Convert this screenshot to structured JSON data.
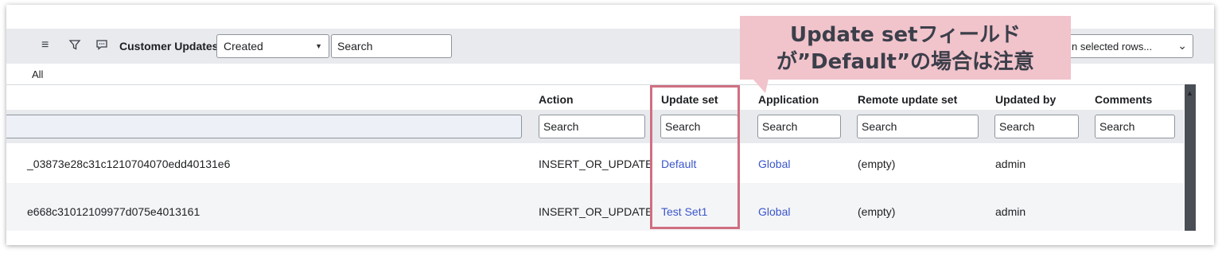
{
  "toolbar": {
    "title": "Customer Updates",
    "field_select": "Created",
    "search_value": "Search",
    "actions_select": "n selected rows..."
  },
  "breadcrumb": "All",
  "columns": [
    "Action",
    "Update set",
    "Application",
    "Remote update set",
    "Updated by",
    "Comments"
  ],
  "column_search": [
    "Search",
    "Search",
    "Search",
    "Search",
    "Search",
    "Search"
  ],
  "rows": [
    {
      "name": "_03873e28c31c1210704070edd40131e6",
      "action": "INSERT_OR_UPDATE",
      "update_set": "Default",
      "application": "Global",
      "remote_update_set": "(empty)",
      "updated_by": "admin"
    },
    {
      "name": "e668c31012109977d075e4013161",
      "action": "INSERT_OR_UPDATE",
      "update_set": "Test Set1",
      "application": "Global",
      "remote_update_set": "(empty)",
      "updated_by": "admin"
    }
  ],
  "callout": {
    "line1": "Update setフィールド",
    "line2": "が”Default”の場合は注意"
  },
  "colors": {
    "link": "#3b56c9",
    "highlight": "#cf6f81",
    "callout_bg": "#f1c3cb"
  },
  "icons": [
    "hamburger-menu-icon",
    "filter-icon",
    "comment-icon",
    "caret-down-icon",
    "chevron-down-icon",
    "scroll-up-icon"
  ]
}
